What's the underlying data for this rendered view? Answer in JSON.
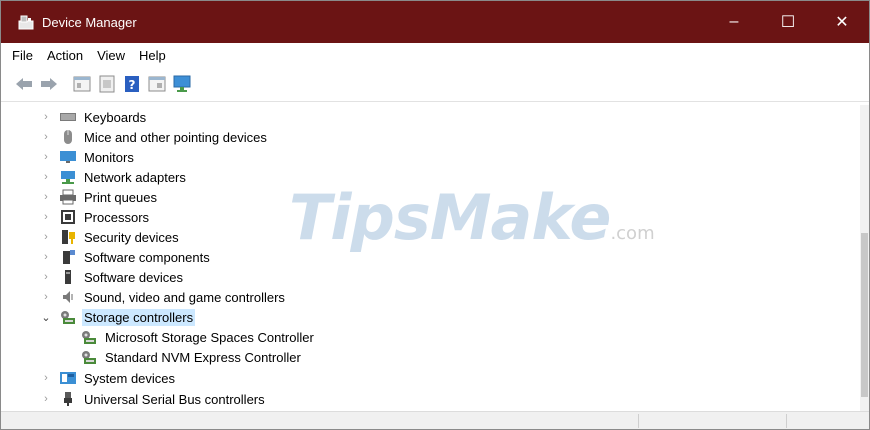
{
  "window": {
    "title": "Device Manager",
    "titlebar_color": "#6b1414",
    "controls": {
      "minimize": "–",
      "maximize": "☐",
      "close": "✕"
    }
  },
  "menu": {
    "items": [
      "File",
      "Action",
      "View",
      "Help"
    ]
  },
  "toolbar": {
    "icons": [
      "back-arrow-icon",
      "forward-arrow-icon",
      "properties-icon",
      "refresh-icon",
      "help-icon",
      "console-icon",
      "monitor-icon"
    ]
  },
  "watermark": {
    "brand": "TipsMake",
    "suffix": ".com"
  },
  "tree": {
    "items": [
      {
        "label": "Keyboards",
        "icon": "keyboard-icon",
        "expanded": false
      },
      {
        "label": "Mice and other pointing devices",
        "icon": "mouse-icon",
        "expanded": false
      },
      {
        "label": "Monitors",
        "icon": "monitor-icon",
        "expanded": false
      },
      {
        "label": "Network adapters",
        "icon": "network-adapter-icon",
        "expanded": false
      },
      {
        "label": "Print queues",
        "icon": "printer-icon",
        "expanded": false
      },
      {
        "label": "Processors",
        "icon": "processor-icon",
        "expanded": false
      },
      {
        "label": "Security devices",
        "icon": "security-device-icon",
        "expanded": false
      },
      {
        "label": "Software components",
        "icon": "software-component-icon",
        "expanded": false
      },
      {
        "label": "Software devices",
        "icon": "software-device-icon",
        "expanded": false
      },
      {
        "label": "Sound, video and game controllers",
        "icon": "speaker-icon",
        "expanded": false
      },
      {
        "label": "Storage controllers",
        "icon": "storage-controller-icon",
        "expanded": true,
        "selected": true
      },
      {
        "label": "Microsoft Storage Spaces Controller",
        "icon": "storage-controller-icon",
        "child": true
      },
      {
        "label": "Standard NVM Express Controller",
        "icon": "storage-controller-icon",
        "child": true
      },
      {
        "label": "System devices",
        "icon": "system-device-icon",
        "expanded": false
      },
      {
        "label": "Universal Serial Bus controllers",
        "icon": "usb-icon",
        "expanded": false
      }
    ]
  },
  "colors": {
    "selection": "#cce8ff",
    "accent": "#0078d7"
  }
}
